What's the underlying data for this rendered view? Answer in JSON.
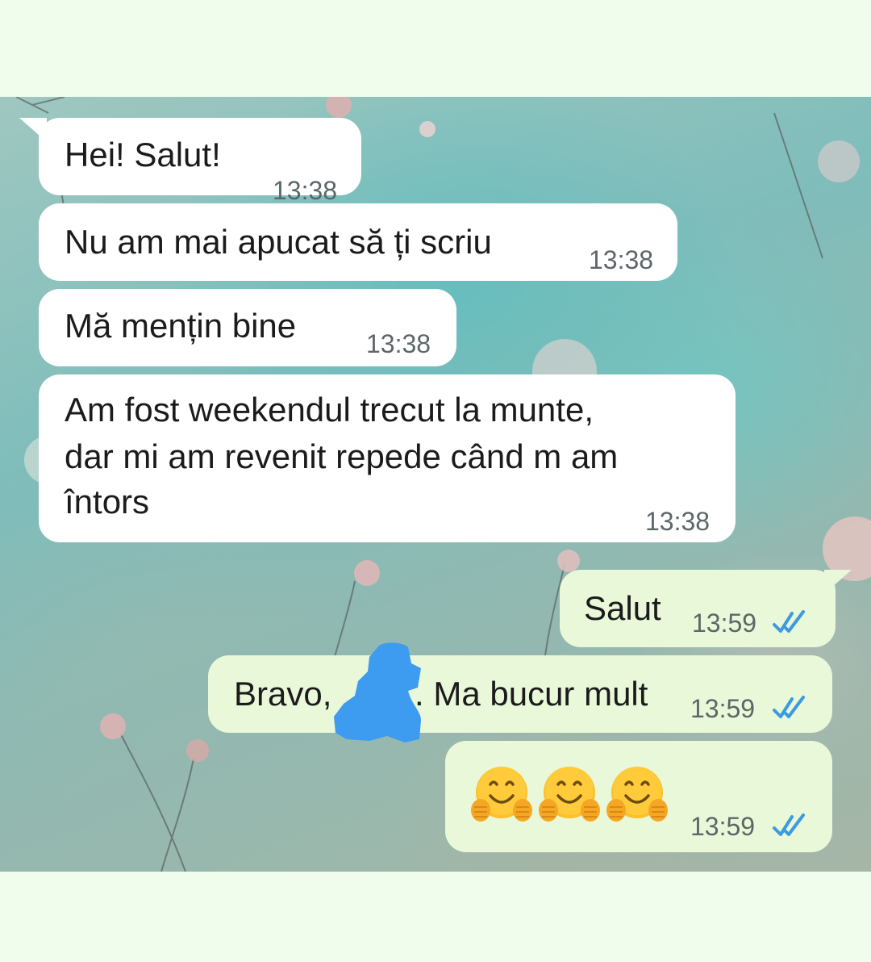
{
  "messages": [
    {
      "direction": "incoming",
      "text": "Hei! Salut!",
      "time": "13:38"
    },
    {
      "direction": "incoming",
      "text": "Nu am mai apucat să ți scriu",
      "time": "13:38"
    },
    {
      "direction": "incoming",
      "text": "Mă mențin bine",
      "time": "13:38"
    },
    {
      "direction": "incoming",
      "lines": [
        "Am fost weekendul trecut la munte,",
        "dar mi am revenit repede când m am",
        "întors"
      ],
      "time": "13:38"
    },
    {
      "direction": "outgoing",
      "text": "Salut",
      "time": "13:59",
      "status": "read",
      "status_icon": "double-check-icon"
    },
    {
      "direction": "outgoing",
      "text_before": "Bravo,",
      "text_after": ". Ma bucur mult",
      "redacted": true,
      "time": "13:59",
      "status": "read",
      "status_icon": "double-check-icon"
    },
    {
      "direction": "outgoing",
      "emojis": [
        "hugging-face-icon",
        "hugging-face-icon",
        "hugging-face-icon"
      ],
      "time": "13:59",
      "status": "read",
      "status_icon": "double-check-icon"
    }
  ],
  "colors": {
    "incoming_bubble": "#ffffff",
    "outgoing_bubble": "#e8f8d9",
    "read_tick": "#3b9be0",
    "redaction": "#3d9bf0",
    "page_background": "#f1fdec"
  }
}
